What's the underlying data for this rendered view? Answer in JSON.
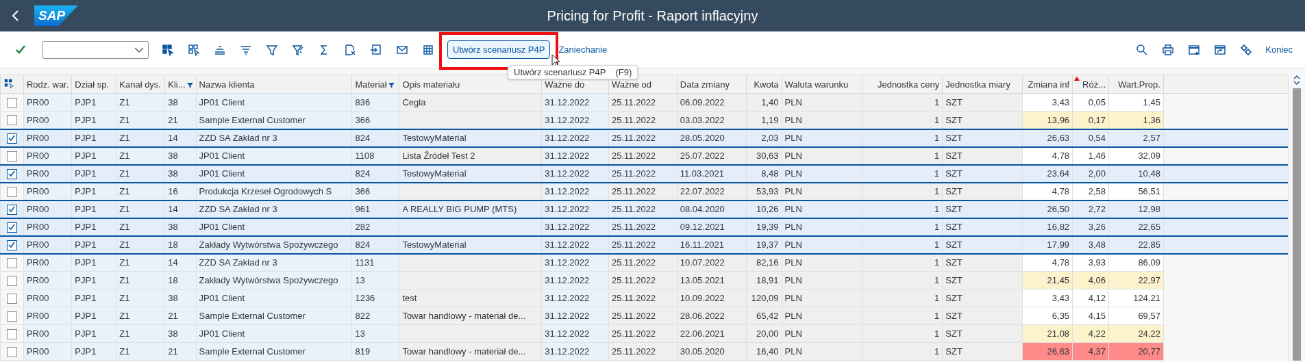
{
  "shell": {
    "logo": "SAP",
    "title": "Pricing for Profit - Raport inflacyjny"
  },
  "toolbar": {
    "primary_button": "Utwórz scenariusz P4P",
    "cancel_link": "Zaniechanie",
    "exit_link": "Koniec",
    "tooltip": {
      "text": "Utwórz scenariusz P4P",
      "shortcut": "(F9)"
    }
  },
  "table": {
    "columns": [
      {
        "label": "Rodz. war.",
        "kind": "key",
        "filter": false,
        "sorted": false
      },
      {
        "label": "Dział sp.",
        "kind": "key",
        "filter": false,
        "sorted": false
      },
      {
        "label": "Kanał dys.",
        "kind": "key",
        "filter": false,
        "sorted": false
      },
      {
        "label": "Kli...",
        "kind": "key",
        "filter": true,
        "sorted": false
      },
      {
        "label": "Nazwa klienta",
        "kind": "key",
        "filter": false,
        "sorted": false
      },
      {
        "label": "Materiał",
        "kind": "key",
        "filter": true,
        "sorted": false
      },
      {
        "label": "Opis materiału",
        "kind": "plain",
        "filter": false,
        "sorted": false
      },
      {
        "label": "Ważne do",
        "kind": "key",
        "filter": false,
        "sorted": false
      },
      {
        "label": "Ważne od",
        "kind": "plain",
        "filter": false,
        "sorted": false
      },
      {
        "label": "Data zmiany",
        "kind": "plain",
        "filter": false,
        "sorted": false
      },
      {
        "label": "Kwota",
        "kind": "amount",
        "filter": false,
        "sorted": false
      },
      {
        "label": "Waluta warunku",
        "kind": "plain",
        "filter": false,
        "sorted": false
      },
      {
        "label": "Jednostka ceny",
        "kind": "amount",
        "filter": false,
        "sorted": false
      },
      {
        "label": "Jednostka miary",
        "kind": "plain",
        "filter": false,
        "sorted": false
      },
      {
        "label": "Zmiana inf",
        "kind": "status",
        "filter": false,
        "sorted": false
      },
      {
        "label": "Róż...",
        "kind": "status",
        "filter": false,
        "sorted": true
      },
      {
        "label": "Wart.Prop.",
        "kind": "status",
        "filter": false,
        "sorted": false
      }
    ],
    "rows": [
      {
        "checked": false,
        "color": "#ffffff",
        "cells": [
          "PR00",
          "PJP1",
          "Z1",
          "38",
          "JP01 Client",
          "836",
          "Cegla",
          "31.12.2022",
          "25.11.2022",
          "06.09.2022",
          "1,40",
          "PLN",
          "1",
          "SZT",
          "3,43",
          "0,05",
          "1,45"
        ]
      },
      {
        "checked": false,
        "color": "#fcf2cb",
        "cells": [
          "PR00",
          "PJP1",
          "Z1",
          "21",
          "Sample External Customer",
          "366",
          null,
          "31.12.2022",
          "25.11.2022",
          "03.03.2022",
          "1,19",
          "PLN",
          "1",
          "SZT",
          "13,96",
          "0,17",
          "1,36"
        ]
      },
      {
        "checked": true,
        "cells": [
          "PR00",
          "PJP1",
          "Z1",
          "14",
          "ZZD SA Zakład nr 3",
          "824",
          "TestowyMaterial",
          "31.12.2022",
          "25.11.2022",
          "28.05.2020",
          "2,03",
          "PLN",
          "1",
          "SZT",
          "26,63",
          "0,54",
          "2,57"
        ]
      },
      {
        "checked": false,
        "color": "#ffffff",
        "cells": [
          "PR00",
          "PJP1",
          "Z1",
          "38",
          "JP01 Client",
          "1108",
          "Lista Źródeł Test 2",
          "31.12.2022",
          "25.11.2022",
          "25.07.2022",
          "30,63",
          "PLN",
          "1",
          "SZT",
          "4,78",
          "1,46",
          "32,09"
        ]
      },
      {
        "checked": true,
        "cells": [
          "PR00",
          "PJP1",
          "Z1",
          "38",
          "JP01 Client",
          "824",
          "TestowyMaterial",
          "31.12.2022",
          "25.11.2022",
          "11.03.2021",
          "8,48",
          "PLN",
          "1",
          "SZT",
          "23,64",
          "2,00",
          "10,48"
        ]
      },
      {
        "checked": false,
        "color": "#ffffff",
        "cells": [
          "PR00",
          "PJP1",
          "Z1",
          "16",
          "Produkcja Krzeseł Ogrodowych S",
          "366",
          null,
          "31.12.2022",
          "25.11.2022",
          "22.07.2022",
          "53,93",
          "PLN",
          "1",
          "SZT",
          "4,78",
          "2,58",
          "56,51"
        ]
      },
      {
        "checked": true,
        "cells": [
          "PR00",
          "PJP1",
          "Z1",
          "14",
          "ZZD SA Zakład nr 3",
          "961",
          "A REALLY BIG PUMP (MTS)",
          "31.12.2022",
          "25.11.2022",
          "08.04.2020",
          "10,26",
          "PLN",
          "1",
          "SZT",
          "26,50",
          "2,72",
          "12,98"
        ]
      },
      {
        "checked": true,
        "cells": [
          "PR00",
          "PJP1",
          "Z1",
          "38",
          "JP01 Client",
          "282",
          null,
          "31.12.2022",
          "25.11.2022",
          "09.12.2021",
          "19,39",
          "PLN",
          "1",
          "SZT",
          "16,82",
          "3,26",
          "22,65"
        ]
      },
      {
        "checked": true,
        "cells": [
          "PR00",
          "PJP1",
          "Z1",
          "18",
          "Zakłady Wytwórstwa Spożywczego",
          "824",
          "TestowyMaterial",
          "31.12.2022",
          "25.11.2022",
          "16.11.2021",
          "19,37",
          "PLN",
          "1",
          "SZT",
          "17,99",
          "3,48",
          "22,85"
        ]
      },
      {
        "checked": false,
        "color": "#ffffff",
        "cells": [
          "PR00",
          "PJP1",
          "Z1",
          "14",
          "ZZD SA Zakład nr 3",
          "1131",
          null,
          "31.12.2022",
          "25.11.2022",
          "10.07.2022",
          "82,16",
          "PLN",
          "1",
          "SZT",
          "4,78",
          "3,93",
          "86,09"
        ]
      },
      {
        "checked": false,
        "color": "#fcf2cb",
        "cells": [
          "PR00",
          "PJP1",
          "Z1",
          "18",
          "Zakłady Wytwórstwa Spożywczego",
          "13",
          null,
          "31.12.2022",
          "25.11.2022",
          "13.05.2021",
          "18,91",
          "PLN",
          "1",
          "SZT",
          "21,45",
          "4,06",
          "22,97"
        ]
      },
      {
        "checked": false,
        "color": "#ffffff",
        "cells": [
          "PR00",
          "PJP1",
          "Z1",
          "38",
          "JP01 Client",
          "1236",
          "test",
          "31.12.2022",
          "25.11.2022",
          "10.09.2022",
          "120,09",
          "PLN",
          "1",
          "SZT",
          "3,43",
          "4,12",
          "124,21"
        ]
      },
      {
        "checked": false,
        "color": "#ffffff",
        "cells": [
          "PR00",
          "PJP1",
          "Z1",
          "21",
          "Sample External Customer",
          "822",
          "Towar handlowy - materiał de...",
          "31.12.2022",
          "25.11.2022",
          "28.06.2022",
          "65,42",
          "PLN",
          "1",
          "SZT",
          "6,35",
          "4,15",
          "69,57"
        ]
      },
      {
        "checked": false,
        "color": "#fcf2cb",
        "cells": [
          "PR00",
          "PJP1",
          "Z1",
          "38",
          "JP01 Client",
          "13",
          null,
          "31.12.2022",
          "25.11.2022",
          "22.06.2021",
          "20,00",
          "PLN",
          "1",
          "SZT",
          "21,08",
          "4,22",
          "24,22"
        ]
      },
      {
        "checked": false,
        "color": "#ff8a8a",
        "cells": [
          "PR00",
          "PJP1",
          "Z1",
          "21",
          "Sample External Customer",
          "819",
          "Towar handlowy - materiał de...",
          "31.12.2022",
          "25.11.2022",
          "30.05.2020",
          "16,40",
          "PLN",
          "1",
          "SZT",
          "26,63",
          "4,37",
          "20,77"
        ]
      }
    ]
  }
}
